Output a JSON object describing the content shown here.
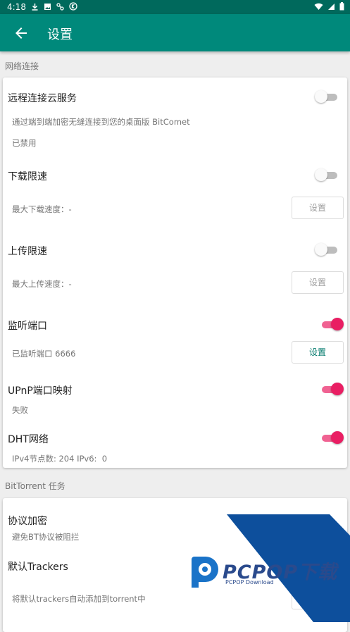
{
  "status_bar": {
    "time": "4:18"
  },
  "app_bar": {
    "title": "设置"
  },
  "sections": {
    "network": {
      "header": "网络连接"
    },
    "bittorrent": {
      "header": "BitTorrent 任务"
    }
  },
  "remote": {
    "title": "远程连接云服务",
    "description": "通过端到端加密无缝连接到您的桌面版 BitComet",
    "status": "已禁用",
    "enabled": false
  },
  "download_limit": {
    "title": "下载限速",
    "value": "最大下载速度：-",
    "button": "设置",
    "enabled": false
  },
  "upload_limit": {
    "title": "上传限速",
    "value": "最大上传速度：-",
    "button": "设置",
    "enabled": false
  },
  "listen_port": {
    "title": "监听端口",
    "value": "已监听端口 6666",
    "button": "设置",
    "enabled": true
  },
  "upnp": {
    "title": "UPnP端口映射",
    "status": "失败",
    "enabled": true
  },
  "dht": {
    "title": "DHT网络",
    "status": "IPv4节点数: 204 IPv6:  0",
    "enabled": true
  },
  "encryption": {
    "title": "协议加密",
    "description": "避免BT协议被阻拦"
  },
  "trackers": {
    "title": "默认Trackers",
    "description": "将默认trackers自动添加到torrent中"
  },
  "watermark": {
    "text": "PCPOP下载",
    "sub": "PCPOP Download"
  },
  "colors": {
    "status_bar": "#00695c",
    "app_bar": "#00897b",
    "switch_on": "#e91e63",
    "button_enabled_text": "#00796b"
  }
}
